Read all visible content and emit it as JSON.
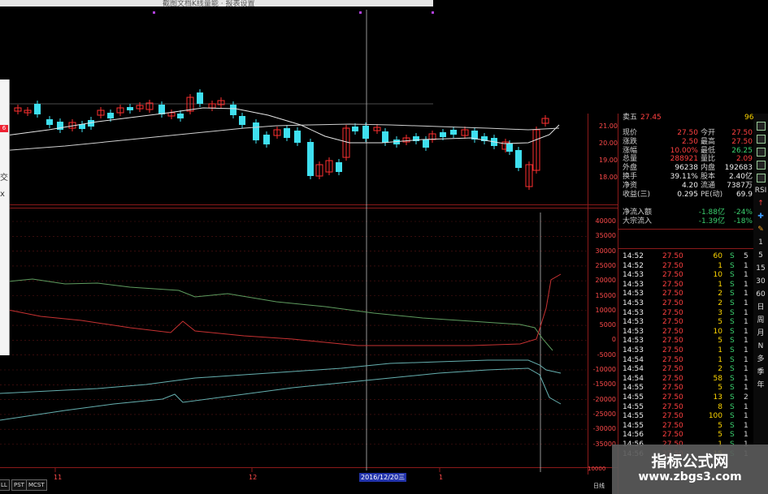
{
  "window": {
    "title": "截图文档K线量能 · 报表设置"
  },
  "price_axis": [
    "21.00",
    "20.00",
    "19.00",
    "18.00"
  ],
  "flow_axis": [
    "40000",
    "35000",
    "30000",
    "25000",
    "20000",
    "15000",
    "10000",
    "5000",
    "0",
    "-5000",
    "-10000",
    "-15000",
    "-20000",
    "-25000",
    "-30000",
    "-35000"
  ],
  "bottom_axis_tail": "10000",
  "dates": {
    "d1": "11",
    "d2": "12",
    "cursor": "2016/12/20三",
    "d3": "1"
  },
  "bottom_tabs": [
    "LL",
    "PST",
    "MCST"
  ],
  "bottom_right": "日线",
  "left_popup": {
    "badge": "6",
    "chars": [
      "交",
      "x"
    ]
  },
  "quote": {
    "row0": {
      "label": "卖五",
      "price": "27.45",
      "vol": "96"
    },
    "rows": [
      {
        "l1": "现价",
        "v1": "27.50",
        "l2": "今开",
        "v2": "27.50"
      },
      {
        "l1": "涨跌",
        "v1": "2.50",
        "l2": "最高",
        "v2": "27.50"
      },
      {
        "l1": "涨幅",
        "v1": "10.00%",
        "l2": "最低",
        "v2": "26.25"
      },
      {
        "l1": "总量",
        "v1": "288921",
        "l2": "量比",
        "v2": "2.09"
      },
      {
        "l1": "外盘",
        "v1": "96238",
        "l2": "内盘",
        "v2": "192683"
      },
      {
        "l1": "换手",
        "v1": "39.11%",
        "l2": "股本",
        "v2": "2.40亿"
      },
      {
        "l1": "净资",
        "v1": "4.20",
        "l2": "流通",
        "v2": "7387万"
      },
      {
        "l1": "收益(三)",
        "v1": "0.295",
        "l2": "PE(动)",
        "v2": "69.9"
      }
    ],
    "flow": [
      {
        "label": "净流入额",
        "value": "-1.88亿",
        "pct": "-24%"
      },
      {
        "label": "大宗流入",
        "value": "-1.39亿",
        "pct": "-18%"
      }
    ]
  },
  "ticks": [
    {
      "t": "14:52",
      "p": "27.50",
      "v": "60",
      "s": "S",
      "n": "5"
    },
    {
      "t": "14:52",
      "p": "27.50",
      "v": "1",
      "s": "S",
      "n": "1"
    },
    {
      "t": "14:53",
      "p": "27.50",
      "v": "10",
      "s": "S",
      "n": "1"
    },
    {
      "t": "14:53",
      "p": "27.50",
      "v": "1",
      "s": "S",
      "n": "1"
    },
    {
      "t": "14:53",
      "p": "27.50",
      "v": "2",
      "s": "S",
      "n": "1"
    },
    {
      "t": "14:53",
      "p": "27.50",
      "v": "2",
      "s": "S",
      "n": "1"
    },
    {
      "t": "14:53",
      "p": "27.50",
      "v": "3",
      "s": "S",
      "n": "1"
    },
    {
      "t": "14:53",
      "p": "27.50",
      "v": "5",
      "s": "S",
      "n": "1"
    },
    {
      "t": "14:53",
      "p": "27.50",
      "v": "10",
      "s": "S",
      "n": "1"
    },
    {
      "t": "14:53",
      "p": "27.50",
      "v": "5",
      "s": "S",
      "n": "1"
    },
    {
      "t": "14:53",
      "p": "27.50",
      "v": "1",
      "s": "S",
      "n": "1"
    },
    {
      "t": "14:54",
      "p": "27.50",
      "v": "1",
      "s": "S",
      "n": "1"
    },
    {
      "t": "14:54",
      "p": "27.50",
      "v": "2",
      "s": "S",
      "n": "1"
    },
    {
      "t": "14:54",
      "p": "27.50",
      "v": "58",
      "s": "S",
      "n": "1"
    },
    {
      "t": "14:55",
      "p": "27.50",
      "v": "5",
      "s": "S",
      "n": "1"
    },
    {
      "t": "14:55",
      "p": "27.50",
      "v": "13",
      "s": "S",
      "n": "2"
    },
    {
      "t": "14:55",
      "p": "27.50",
      "v": "8",
      "s": "S",
      "n": "1"
    },
    {
      "t": "14:55",
      "p": "27.50",
      "v": "100",
      "s": "S",
      "n": "1"
    },
    {
      "t": "14:55",
      "p": "27.50",
      "v": "5",
      "s": "S",
      "n": "1"
    },
    {
      "t": "14:56",
      "p": "27.50",
      "v": "5",
      "s": "S",
      "n": "1"
    },
    {
      "t": "14:56",
      "p": "27.50",
      "v": "1",
      "s": "S",
      "n": "1"
    },
    {
      "t": "14:56",
      "p": "27.50",
      "v": "15",
      "s": "S",
      "n": "1"
    }
  ],
  "toolbar": [
    {
      "icon": "kline-icon",
      "label": ""
    },
    {
      "icon": "flow-icon",
      "label": ""
    },
    {
      "icon": "chart-icon",
      "label": ""
    },
    {
      "icon": "bar-icon",
      "label": ""
    },
    {
      "icon": "list-icon",
      "label": ""
    },
    {
      "icon": "rsi-icon",
      "label": "RSI"
    },
    {
      "icon": "up-icon",
      "label": "↑"
    },
    {
      "icon": "cross-icon",
      "label": "✚"
    },
    {
      "icon": "pencil-icon",
      "label": "✎"
    },
    {
      "icon": "period-1",
      "label": "1"
    },
    {
      "icon": "period-5",
      "label": "5"
    },
    {
      "icon": "period-15",
      "label": "15"
    },
    {
      "icon": "period-30",
      "label": "30"
    },
    {
      "icon": "period-60",
      "label": "60"
    },
    {
      "icon": "day",
      "label": "日"
    },
    {
      "icon": "week",
      "label": "周"
    },
    {
      "icon": "month",
      "label": "月"
    },
    {
      "icon": "multi",
      "label": "N"
    },
    {
      "icon": "many",
      "label": "多"
    },
    {
      "icon": "season",
      "label": "季"
    },
    {
      "icon": "year",
      "label": "年"
    }
  ],
  "watermark": {
    "title": "指标公式网",
    "url": "www.zbgs3.com"
  },
  "colors": {
    "up": "#ff3030",
    "down": "#3fe0f0",
    "ma": "#cfcfcf",
    "grid": "#8b1a1a",
    "red_line": "#c83232",
    "green_line": "#5f9c5f",
    "cyan_line": "#66b0b0"
  }
}
